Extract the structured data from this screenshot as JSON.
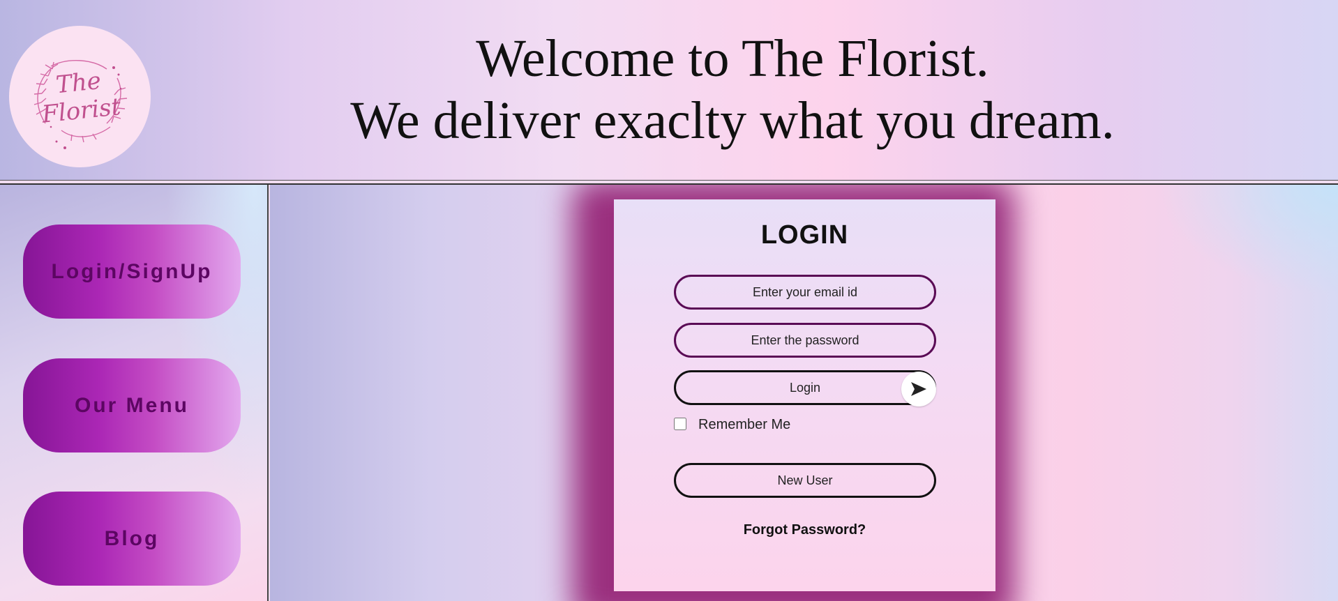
{
  "header": {
    "logo_line1": "The",
    "logo_line2": "Florist",
    "welcome_line1": "Welcome to The Florist.",
    "welcome_line2": "We deliver exaclty what you dream."
  },
  "sidebar": {
    "items": [
      {
        "label": "Login/SignUp"
      },
      {
        "label": "Our Menu"
      },
      {
        "label": "Blog"
      }
    ]
  },
  "login": {
    "title": "LOGIN",
    "email_placeholder": "Enter your email id",
    "password_placeholder": "Enter the password",
    "login_label": "Login",
    "send_icon": "send-arrow-icon",
    "remember_label": "Remember Me",
    "new_user_label": "New User",
    "forgot_label": "Forgot Password?"
  },
  "colors": {
    "nav_gradient_start": "#861596",
    "nav_text": "#5c0662",
    "field_border": "#5a0b55",
    "card_glow": "#9a2f7e"
  }
}
